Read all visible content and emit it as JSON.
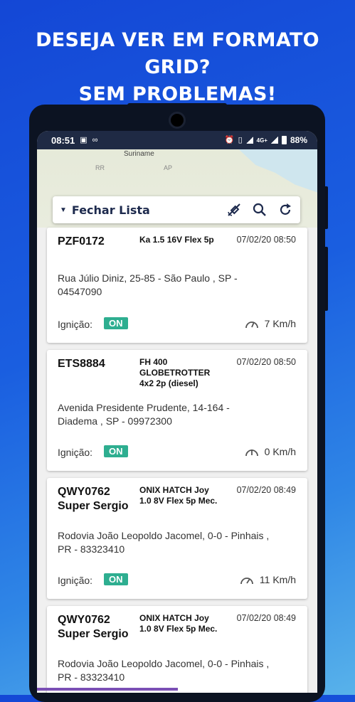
{
  "headline": {
    "line1": "DESEJA VER EM FORMATO GRID?",
    "line2": "SEM PROBLEMAS!"
  },
  "statusbar": {
    "time": "08:51",
    "network": "4G+",
    "battery": "88%"
  },
  "map": {
    "label": "Suriname",
    "abbr1": "RR",
    "abbr2": "AP"
  },
  "toolbar": {
    "title": "Fechar Lista",
    "icons": [
      "satellite-icon",
      "search-icon",
      "refresh-icon"
    ]
  },
  "accent_color": "#2eae90",
  "vehicles": [
    {
      "plate": "PZF0172",
      "model": "Ka 1.5 16V Flex 5p",
      "datetime": "07/02/20 08:50",
      "address": "Rua Júlio Diniz, 25-85 - São Paulo , SP - 04547090",
      "ignition_label": "Ignição:",
      "ignition": "ON",
      "speed": "7 Km/h"
    },
    {
      "plate": "ETS8884",
      "model": "FH 400 GLOBETROTTER 4x2 2p (diesel)",
      "datetime": "07/02/20 08:50",
      "address": "Avenida Presidente Prudente, 14-164 - Diadema , SP - 09972300",
      "ignition_label": "Ignição:",
      "ignition": "ON",
      "speed": "0 Km/h"
    },
    {
      "plate": "QWY0762 Super Sergio",
      "model": "ONIX HATCH Joy 1.0 8V Flex 5p Mec.",
      "datetime": "07/02/20 08:49",
      "address": "Rodovia João Leopoldo Jacomel, 0-0 - Pinhais , PR - 83323410",
      "ignition_label": "Ignição:",
      "ignition": "ON",
      "speed": "11 Km/h"
    },
    {
      "plate": "QWY0762 Super Sergio",
      "model": "ONIX HATCH Joy 1.0 8V Flex 5p Mec.",
      "datetime": "07/02/20 08:49",
      "address": "Rodovia João Leopoldo Jacomel, 0-0 - Pinhais , PR - 83323410"
    }
  ]
}
